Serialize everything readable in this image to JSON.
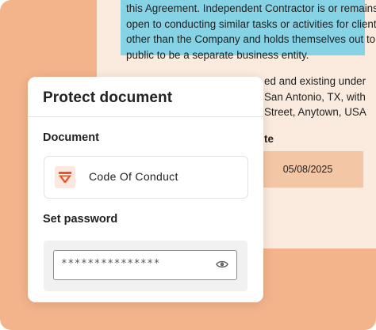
{
  "document_text": {
    "highlighted_lines": [
      "this Agreement. Independent Contractor is or remains",
      "open to conducting similar tasks or activities for clients",
      "other than the Company and holds themselves out to the",
      "public to be a separate business entity."
    ],
    "partial_lines": [
      "ed and existing under",
      "San Antonio, TX, with",
      "Street, Anytown, USA"
    ],
    "date_header_partial": "te",
    "date_value": "05/08/2025"
  },
  "modal": {
    "title": "Protect document",
    "document_label": "Document",
    "document_name": "Code Of Conduct",
    "password_label": "Set password",
    "password_value": "***************"
  },
  "colors": {
    "background_accent": "#f3b48b",
    "page": "#fbebde",
    "highlight": "#86d3e6",
    "date_cell": "#f3c6a6",
    "icon_red": "#e8552c"
  }
}
